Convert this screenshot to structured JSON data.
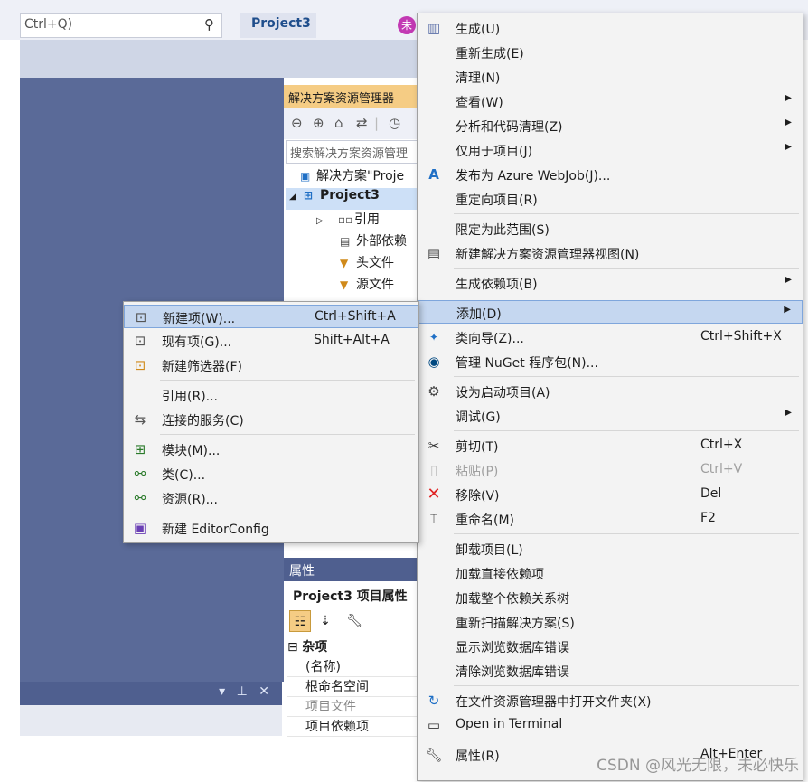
{
  "topbar": {
    "search_text": "Ctrl+Q)",
    "project_title": "Project3",
    "user_badge": "未"
  },
  "bottom_tab": {
    "icons": "▾ ⊥ ✕"
  },
  "solution_explorer": {
    "header": "解决方案资源管理器",
    "search_placeholder": "搜索解决方案资源管理",
    "tree": [
      {
        "label": "解决方案\"Proje",
        "icon": "solution-icon"
      },
      {
        "label": "Project3",
        "icon": "project-icon"
      },
      {
        "label": "引用",
        "icon": "references-icon"
      },
      {
        "label": "外部依赖",
        "icon": "external-deps-icon"
      },
      {
        "label": "头文件",
        "icon": "filter-folder-icon"
      },
      {
        "label": "源文件",
        "icon": "filter-folder-icon"
      }
    ]
  },
  "properties": {
    "header": "属性",
    "title": "Project3  项目属性",
    "category": "杂项",
    "rows": [
      "(名称)",
      "根命名空间",
      "项目文件",
      "项目依赖项"
    ]
  },
  "main_menu": {
    "items": [
      {
        "label": "生成(U)",
        "icon": "build-icon"
      },
      {
        "label": "重新生成(E)"
      },
      {
        "label": "清理(N)"
      },
      {
        "label": "查看(W)",
        "submenu": true
      },
      {
        "label": "分析和代码清理(Z)",
        "submenu": true
      },
      {
        "label": "仅用于项目(J)",
        "submenu": true
      },
      {
        "label": "发布为 Azure WebJob(J)...",
        "icon": "azure-icon"
      },
      {
        "label": "重定向项目(R)"
      },
      {
        "label": "限定为此范围(S)"
      },
      {
        "label": "新建解决方案资源管理器视图(N)",
        "icon": "new-view-icon"
      },
      {
        "label": "生成依赖项(B)",
        "submenu": true
      },
      {
        "label": "添加(D)",
        "submenu": true,
        "highlighted": true
      },
      {
        "label": "类向导(Z)...",
        "shortcut": "Ctrl+Shift+X",
        "icon": "class-wizard-icon"
      },
      {
        "label": "管理 NuGet 程序包(N)...",
        "icon": "nuget-icon"
      },
      {
        "label": "设为启动项目(A)",
        "icon": "gear-icon"
      },
      {
        "label": "调试(G)",
        "submenu": true
      },
      {
        "label": "剪切(T)",
        "shortcut": "Ctrl+X",
        "icon": "scissors-icon"
      },
      {
        "label": "粘贴(P)",
        "shortcut": "Ctrl+V",
        "icon": "paste-icon",
        "disabled": true
      },
      {
        "label": "移除(V)",
        "shortcut": "Del",
        "icon": "remove-icon"
      },
      {
        "label": "重命名(M)",
        "shortcut": "F2",
        "icon": "rename-icon"
      },
      {
        "label": "卸载项目(L)"
      },
      {
        "label": "加载直接依赖项"
      },
      {
        "label": "加载整个依赖关系树"
      },
      {
        "label": "重新扫描解决方案(S)"
      },
      {
        "label": "显示浏览数据库错误"
      },
      {
        "label": "清除浏览数据库错误"
      },
      {
        "label": "在文件资源管理器中打开文件夹(X)",
        "icon": "open-folder-icon"
      },
      {
        "label": "Open in Terminal",
        "icon": "terminal-icon"
      },
      {
        "label": "属性(R)",
        "shortcut": "Alt+Enter",
        "icon": "wrench-icon"
      }
    ]
  },
  "sub_menu": {
    "items": [
      {
        "label": "新建项(W)...",
        "shortcut": "Ctrl+Shift+A",
        "icon": "new-item-icon",
        "highlighted": true
      },
      {
        "label": "现有项(G)...",
        "shortcut": "Shift+Alt+A",
        "icon": "existing-item-icon"
      },
      {
        "label": "新建筛选器(F)",
        "icon": "new-filter-icon"
      },
      {
        "label": "引用(R)..."
      },
      {
        "label": "连接的服务(C)",
        "icon": "connected-service-icon"
      },
      {
        "label": "模块(M)...",
        "icon": "module-icon"
      },
      {
        "label": "类(C)...",
        "icon": "class-icon"
      },
      {
        "label": "资源(R)...",
        "icon": "resource-icon"
      },
      {
        "label": "新建 EditorConfig",
        "icon": "editorconfig-icon"
      }
    ]
  },
  "watermark": "CSDN @风光无限，未必快乐"
}
